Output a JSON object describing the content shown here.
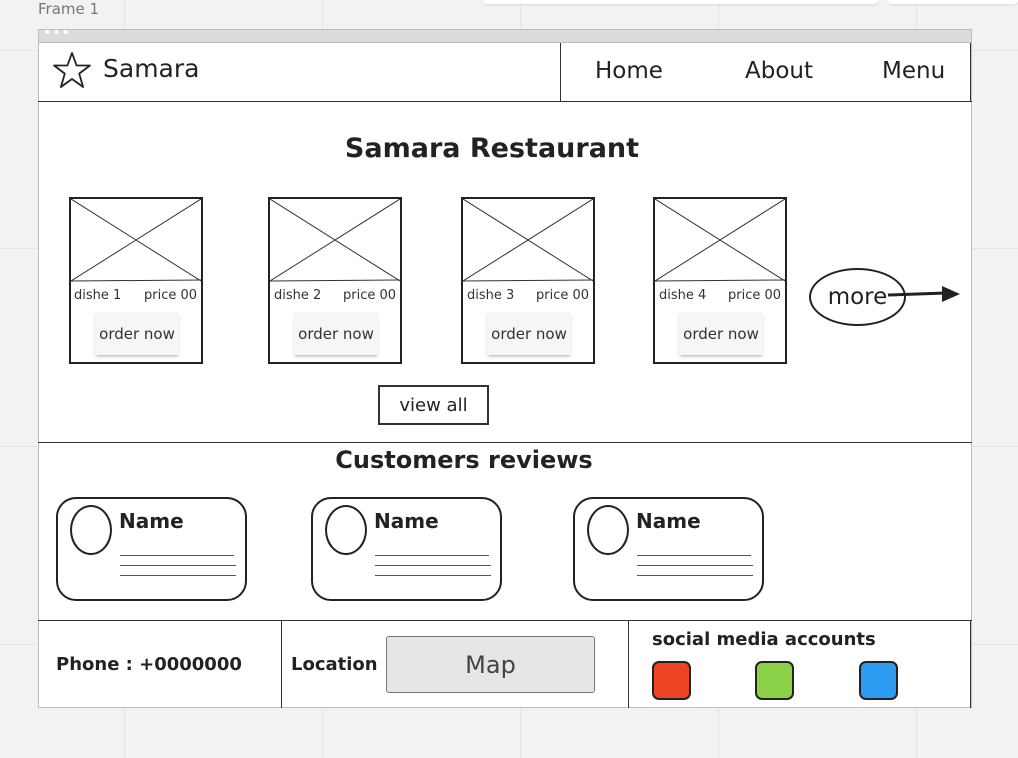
{
  "canvas": {
    "frame_label": "Frame 1"
  },
  "header": {
    "logo_text": "Samara",
    "logo_icon": "star-icon",
    "nav": [
      {
        "label": "Home"
      },
      {
        "label": "About"
      },
      {
        "label": "Menu"
      }
    ]
  },
  "main": {
    "title": "Samara Restaurant",
    "dishes": [
      {
        "name": "dishe 1",
        "price": "price 00",
        "order_label": "order now"
      },
      {
        "name": "dishe 2",
        "price": "price 00",
        "order_label": "order now"
      },
      {
        "name": "dishe 3",
        "price": "price 00",
        "order_label": "order now"
      },
      {
        "name": "dishe 4",
        "price": "price 00",
        "order_label": "order now"
      }
    ],
    "more_label": "more",
    "view_all_label": "view all"
  },
  "reviews": {
    "title": "Customers reviews",
    "items": [
      {
        "name": "Name"
      },
      {
        "name": "Name"
      },
      {
        "name": "Name"
      }
    ]
  },
  "footer": {
    "phone": "Phone : +0000000",
    "location_label": "Location",
    "map_label": "Map",
    "social_title": "social media accounts",
    "social_colors": [
      "#ee4423",
      "#8cd248",
      "#2d9bf0"
    ]
  }
}
